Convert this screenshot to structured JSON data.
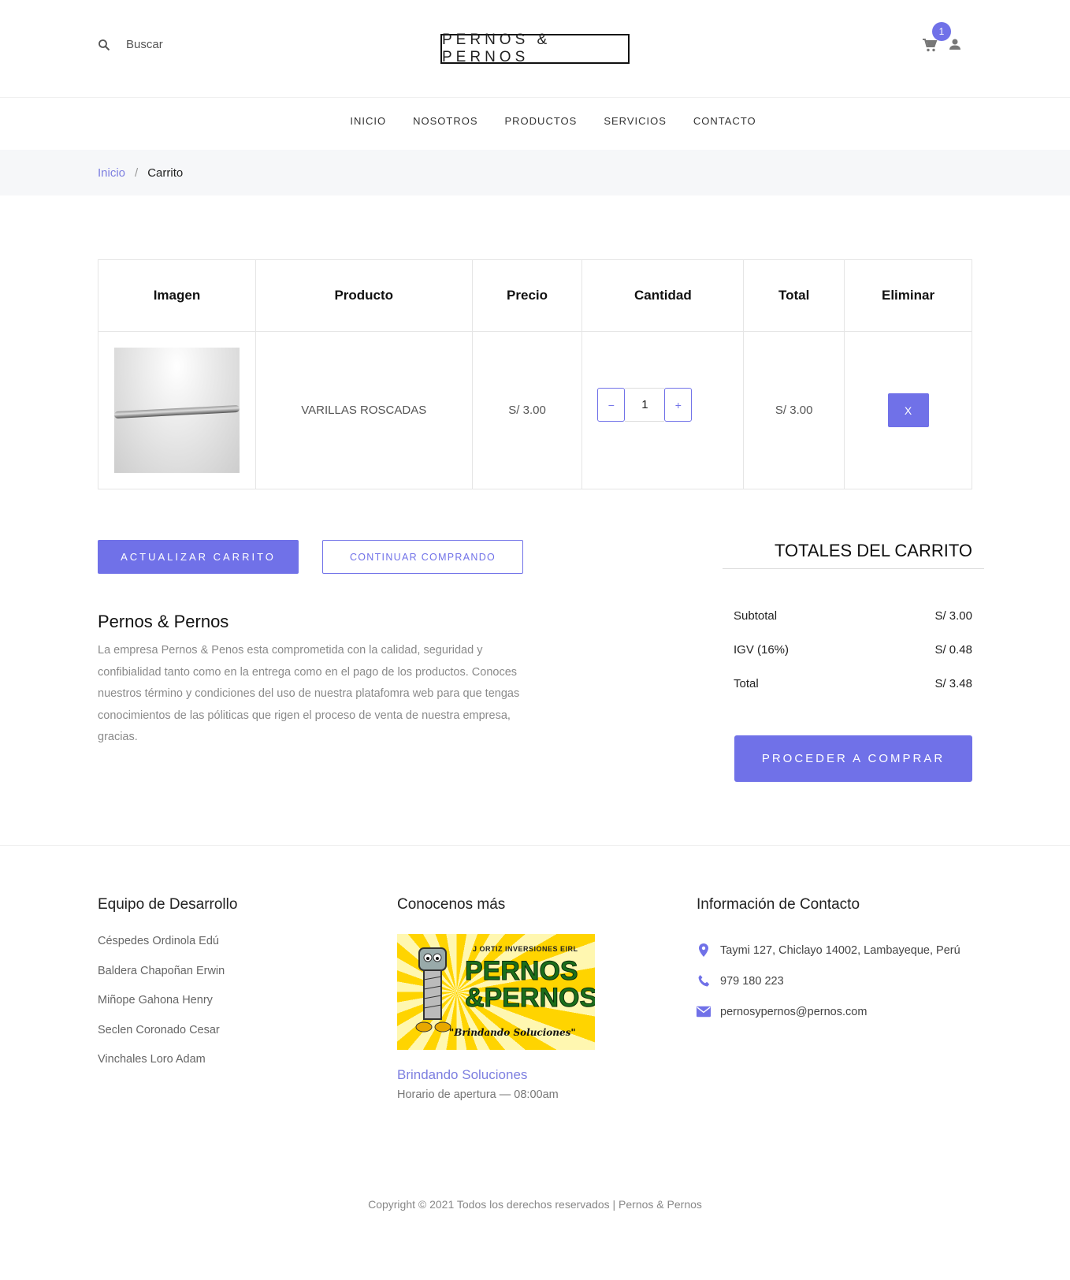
{
  "header": {
    "search_placeholder": "Buscar",
    "logo": "PERNOS & PERNOS",
    "cart_count": "1"
  },
  "nav": [
    "INICIO",
    "NOSOTROS",
    "PRODUCTOS",
    "SERVICIOS",
    "CONTACTO"
  ],
  "breadcrumb": {
    "home": "Inicio",
    "separator": "/",
    "current": "Carrito"
  },
  "cart_table": {
    "headers": [
      "Imagen",
      "Producto",
      "Precio",
      "Cantidad",
      "Total",
      "Eliminar"
    ],
    "rows": [
      {
        "product": "VARILLAS ROSCADAS",
        "price": "S/ 3.00",
        "qty": "1",
        "total": "S/ 3.00",
        "remove": "X",
        "minus": "−",
        "plus": "+"
      }
    ]
  },
  "actions": {
    "update": "ACTUALIZAR CARRITO",
    "continue": "CONTINUAR COMPRANDO"
  },
  "about": {
    "title": "Pernos & Pernos",
    "text": "La empresa Pernos & Penos esta comprometida con la calidad, seguridad y confibialidad tanto como en la entrega como en el pago de los productos. Conoces nuestros término y condiciones del uso de nuestra platafomra web para que tengas conocimientos de las póliticas que rigen el proceso de venta de nuestra empresa, gracias."
  },
  "totals": {
    "title": "TOTALES DEL CARRITO",
    "rows": [
      {
        "label": "Subtotal",
        "value": "S/ 3.00"
      },
      {
        "label": "IGV (16%)",
        "value": "S/ 0.48"
      },
      {
        "label": "Total",
        "value": "S/ 3.48"
      }
    ],
    "checkout": "PROCEDER A COMPRAR"
  },
  "footer": {
    "team_title": "Equipo de Desarrollo",
    "team": [
      "Céspedes Ordinola Edú",
      "Baldera Chapoñan Erwin",
      "Miñope Gahona Henry",
      "Seclen Coronado Cesar",
      "Vinchales Loro Adam"
    ],
    "more_title": "Conocenos más",
    "promo": {
      "company": "J ORTIZ INVERSIONES EIRL",
      "brand_line1": "PERNOS",
      "brand_line2": "&PERNOS",
      "tagline": "\"Brindando Soluciones\""
    },
    "promo_link": "Brindando Soluciones",
    "hours": "Horario de apertura — 08:00am",
    "contact_title": "Información de Contacto",
    "address": "Taymi 127, Chiclayo 14002, Lambayeque, Perú",
    "phone": "979 180 223",
    "email": "pernosypernos@pernos.com"
  },
  "copyright": "Copyright © 2021 Todos los derechos reservados | Pernos & Pernos",
  "colors": {
    "accent": "#7071e8",
    "link": "#7d7fe0",
    "breadcrumb_bg": "#f6f7f9"
  }
}
